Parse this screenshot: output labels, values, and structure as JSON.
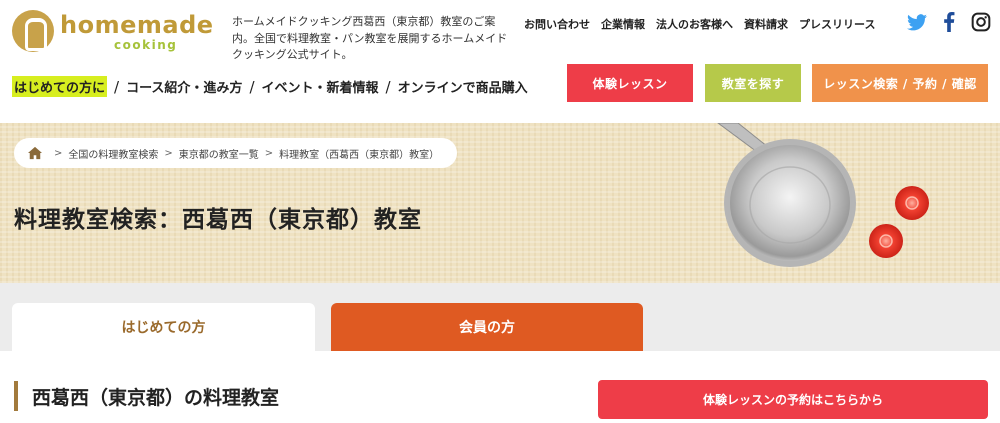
{
  "header": {
    "logo_main": "homemade",
    "logo_sub": "cooking",
    "site_description": "ホームメイドクッキング西葛西（東京都）教室のご案内。全国で料理教室・パン教室を展開するホームメイドクッキング公式サイト。",
    "util_nav": [
      "お問い合わせ",
      "企業情報",
      "法人のお客様へ",
      "資料請求",
      "プレスリリース"
    ],
    "social_icons": [
      "twitter-icon",
      "facebook-icon",
      "instagram-icon"
    ]
  },
  "main_nav": {
    "items": [
      "はじめての方に",
      "コース紹介・進み方",
      "イベント・新着情報",
      "オンラインで商品購入"
    ],
    "separator": "/"
  },
  "header_buttons": {
    "trial": "体験レッスン",
    "find": "教室を探す",
    "search": "レッスン検索 / 予約 / 確認"
  },
  "hero": {
    "breadcrumb": [
      "全国の料理教室検索",
      "東京都の教室一覧",
      "料理教室（西葛西（東京都）教室）"
    ],
    "breadcrumb_sep": ">",
    "title": "料理教室検索：西葛西（東京都）教室"
  },
  "tabs": {
    "first": "はじめての方",
    "member": "会員の方"
  },
  "section": {
    "title": "西葛西（東京都）の料理教室",
    "cta": "体験レッスンの予約はこちらから"
  },
  "colors": {
    "accent_red": "#ee3d48",
    "accent_green": "#b6c94a",
    "accent_orange": "#f0924b",
    "tab_orange": "#df5a22",
    "brand_gold": "#c09a38"
  }
}
